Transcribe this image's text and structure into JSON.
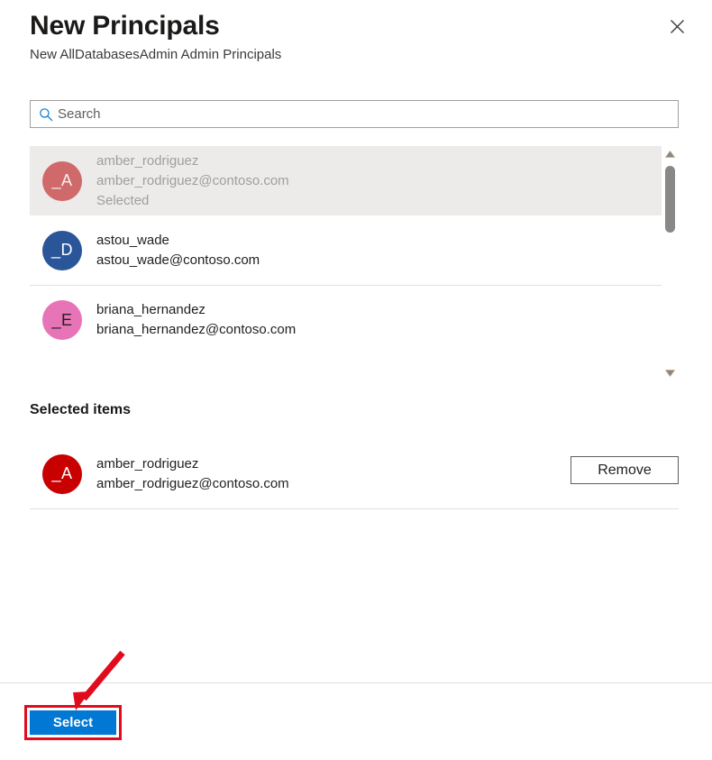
{
  "header": {
    "title": "New Principals",
    "subtitle": "New AllDatabasesAdmin Admin Principals",
    "close_icon": "close-icon"
  },
  "search": {
    "placeholder": "Search",
    "value": "",
    "icon": "search-icon"
  },
  "results": {
    "items": [
      {
        "initials": "_A",
        "name": "amber_rodriguez",
        "email": "amber_rodriguez@contoso.com",
        "status": "Selected",
        "avatar_color": "#d06a6a",
        "avatar_text_color": "#f3f2f1",
        "disabled": true
      },
      {
        "initials": "_D",
        "name": "astou_wade",
        "email": "astou_wade@contoso.com",
        "status": "",
        "avatar_color": "#2a5699",
        "avatar_text_color": "#ffffff",
        "disabled": false
      },
      {
        "initials": "_E",
        "name": "briana_hernandez",
        "email": "briana_hernandez@contoso.com",
        "status": "",
        "avatar_color": "#e874b8",
        "avatar_text_color": "#201f1e",
        "disabled": false
      }
    ],
    "scrollbar": {
      "up_icon": "chevron-up-icon",
      "down_icon": "chevron-down-icon"
    }
  },
  "selected": {
    "heading": "Selected items",
    "items": [
      {
        "initials": "_A",
        "name": "amber_rodriguez",
        "email": "amber_rodriguez@contoso.com",
        "avatar_color": "#c80000",
        "avatar_text_color": "#ffffff",
        "remove_label": "Remove"
      }
    ]
  },
  "footer": {
    "select_label": "Select"
  },
  "annotation": {
    "color": "#e00b1c"
  },
  "colors": {
    "accent": "#0078d4",
    "annotation": "#e00b1c",
    "divider": "#e1dfdd",
    "disabled_row_bg": "#edebe9"
  }
}
